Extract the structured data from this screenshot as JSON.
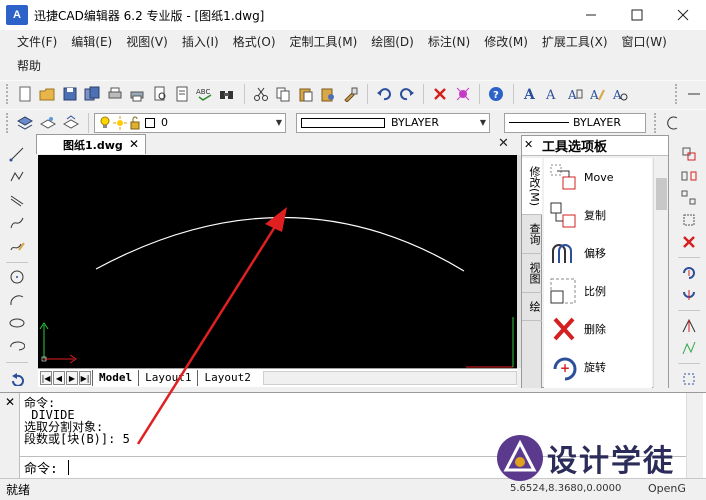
{
  "window": {
    "title": "迅捷CAD编辑器 6.2 专业版  - [图纸1.dwg]",
    "app_icon_text": "A",
    "minimize_icon": "minimize-icon",
    "maximize_icon": "maximize-icon",
    "close_icon": "close-icon"
  },
  "menu": {
    "items": [
      "文件(F)",
      "编辑(E)",
      "视图(V)",
      "插入(I)",
      "格式(O)",
      "定制工具(M)",
      "绘图(D)",
      "标注(N)",
      "修改(M)",
      "扩展工具(X)",
      "窗口(W)",
      "帮助"
    ]
  },
  "layer_bar": {
    "layer_value": "0",
    "color_value": "BYLAYER",
    "linetype_value": "BYLAYER"
  },
  "document": {
    "tab_label": "图纸1.dwg",
    "close_glyph": "✕",
    "doc_close_glyph": "✕"
  },
  "layouts": {
    "tabs": [
      "Model",
      "Layout1",
      "Layout2"
    ],
    "active": "Model"
  },
  "palette": {
    "title": "工具选项板",
    "vertical_tabs": [
      "修改(M)",
      "查询",
      "视图",
      "绘"
    ],
    "items": [
      {
        "label": "Move",
        "icon": "move-icon"
      },
      {
        "label": "复制",
        "icon": "copy-icon"
      },
      {
        "label": "偏移",
        "icon": "offset-icon"
      },
      {
        "label": "比例",
        "icon": "scale-icon"
      },
      {
        "label": "删除",
        "icon": "delete-icon"
      },
      {
        "label": "旋转",
        "icon": "rotate-icon"
      }
    ]
  },
  "command": {
    "history": [
      "命令:",
      " DIVIDE",
      "选取分割对象:",
      "段数或[块(B)]: 5"
    ],
    "prompt": "命令:"
  },
  "status": {
    "text": "就绪",
    "coords": "5.6524,8.3680,0.0000",
    "renderer": "OpenG"
  },
  "watermark": {
    "text": "设计学徒"
  },
  "colors": {
    "canvas": "#000000",
    "arc": "#ffffff",
    "arrow": "#e02020",
    "axis_x": "#e02020",
    "axis_y": "#2ecc40"
  }
}
